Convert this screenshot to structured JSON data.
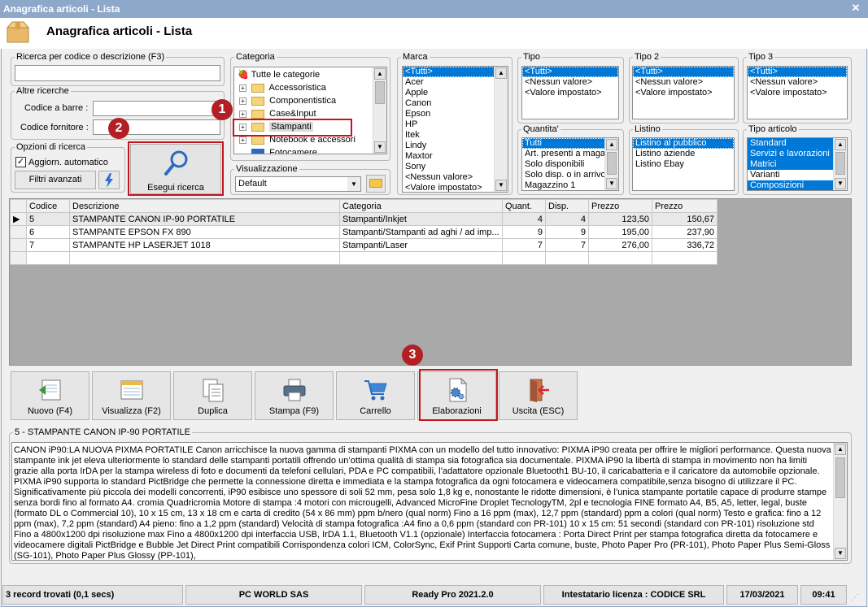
{
  "window": {
    "title": "Anagrafica articoli  - Lista"
  },
  "header": {
    "title": "Anagrafica articoli  - Lista"
  },
  "search": {
    "legend": "Ricerca per codice o descrizione (F3)",
    "value": "",
    "altre_legend": "Altre ricerche",
    "barcode_label": "Codice a barre :",
    "supplier_label": "Codice fornitore :",
    "options_legend": "Opzioni di ricerca",
    "auto_update_label": "Aggiorn. automatico",
    "advanced_filters": "Filtri avanzati",
    "execute_label": "Esegui ricerca"
  },
  "categoria": {
    "legend": "Categoria",
    "items": [
      "Tutte le categorie",
      "Accessoristica",
      "Componentistica",
      "Case&Input",
      "Stampanti",
      "Notebook e accessori",
      "Fotocamere"
    ]
  },
  "visualizzazione": {
    "legend": "Visualizzazione",
    "value": "Default"
  },
  "marca": {
    "legend": "Marca",
    "items": [
      "<Tutti>",
      "Acer",
      "Apple",
      "Canon",
      "Epson",
      "HP",
      "Itek",
      "Lindy",
      "Maxtor",
      "Sony",
      "<Nessun valore>",
      "<Valore impostato>"
    ]
  },
  "tipo": {
    "legend": "Tipo",
    "items": [
      "<Tutti>",
      "<Nessun valore>",
      "<Valore impostato>"
    ]
  },
  "tipo2": {
    "legend": "Tipo 2",
    "items": [
      "<Tutti>",
      "<Nessun valore>",
      "<Valore impostato>"
    ]
  },
  "tipo3": {
    "legend": "Tipo 3",
    "items": [
      "<Tutti>",
      "<Nessun valore>",
      "<Valore impostato>"
    ]
  },
  "quantita": {
    "legend": "Quantita'",
    "items": [
      "Tutti",
      "Art. presenti a magazzino",
      "Solo disponibili",
      "Solo disp. o in arrivo",
      "Magazzino 1"
    ]
  },
  "listino": {
    "legend": "Listino",
    "items": [
      "Listino al pubblico",
      "Listino aziende",
      "Listino Ebay"
    ]
  },
  "tipo_articolo": {
    "legend": "Tipo articolo",
    "items": [
      "Standard",
      "Servizi e lavorazioni",
      "Matrici",
      "Varianti",
      "Composizioni"
    ]
  },
  "grid": {
    "columns": [
      "Codice",
      "Descrizione",
      "Categoria",
      "Quant.",
      "Disp.",
      "Prezzo",
      "Prezzo"
    ],
    "rows": [
      [
        "5",
        "STAMPANTE CANON IP-90 PORTATILE",
        "Stampanti/Inkjet",
        "4",
        "4",
        "123,50",
        "150,67"
      ],
      [
        "6",
        "STAMPANTE EPSON FX 890",
        "Stampanti/Stampanti ad aghi / ad imp...",
        "9",
        "9",
        "195,00",
        "237,90"
      ],
      [
        "7",
        "STAMPANTE HP LASERJET 1018",
        "Stampanti/Laser",
        "7",
        "7",
        "276,00",
        "336,72"
      ]
    ]
  },
  "actions": [
    {
      "label": "Nuovo (F4)",
      "icon": "new-doc-icon"
    },
    {
      "label": "Visualizza (F2)",
      "icon": "view-list-icon"
    },
    {
      "label": "Duplica",
      "icon": "duplicate-icon"
    },
    {
      "label": "Stampa (F9)",
      "icon": "printer-icon"
    },
    {
      "label": "Carrello",
      "icon": "cart-icon"
    },
    {
      "label": "Elaborazioni",
      "icon": "gear-doc-icon"
    },
    {
      "label": "Uscita (ESC)",
      "icon": "exit-icon"
    }
  ],
  "detail": {
    "legend": "5 - STAMPANTE CANON IP-90 PORTATILE",
    "text": "CANON iP90:LA NUOVA PIXMA PORTATILE Canon arricchisce la nuova gamma di stampanti PIXMA con un modello del tutto innovativo: PIXMA iP90 creata per offrire le migliori performance. Questa nuova stampante ink jet eleva ulteriormente lo standard delle stampanti portatili offrendo un’ottima qualità di stampa sia fotografica sia documentale. PIXMA iP90 la libertà di stampa in movimento non ha limiti grazie alla porta IrDA per la stampa wireless di foto e documenti da telefoni cellulari, PDA e PC compatibili, l’adattatore opzionale Bluetooth1 BU-10, il caricabatteria e il caricatore da automobile opzionale. PIXMA iP90 supporta lo standard PictBridge che permette la connessione diretta e immediata e la stampa fotografica da ogni fotocamera e videocamera compatibile,senza bisogno di utilizzare il PC. Significativamente più piccola dei modelli concorrenti, iP90 esibisce uno spessore di soli 52 mm, pesa solo 1,8 kg e, nonostante le ridotte dimensioni, è l’unica stampante portatile capace di produrre stampe senza bordi fino al formato A4. cromia Quadricromia Motore di stampa :4 motori con microugelli, Advanced MicroFine Droplet TecnologyTM, 2pl e tecnologia FINE formato A4, B5, A5, letter, legal, buste (formato DL o Commercial 10), 10 x 15 cm, 13 x 18 cm e carta di credito (54 x 86 mm) ppm b/nero (qual norm) Fino a 16 ppm (max), 12,7 ppm (standard) ppm a colori (qual norm) Testo e grafica: fino a 12 ppm (max), 7,2 ppm (standard) A4 pieno: fino a 1,2 ppm (standard) Velocità di stampa fotografica :A4 fino a 0,6 ppm (standard con PR-101) 10 x 15 cm: 51 secondi (standard con PR-101) risoluzione std Fino a 4800x1200 dpi risoluzione max Fino a 4800x1200 dpi interfaccia USB, IrDA 1.1, Bluetooth V1.1 (opzionale) Interfaccia fotocamera : Porta Direct Print per stampa fotografica diretta da fotocamere e videocamere digitali PictBridge e Bubble Jet Direct Print compatibili Corrispondenza colori ICM, ColorSync, Exif Print Supporti Carta comune, buste, Photo Paper Pro (PR-101), Photo Paper Plus Semi-Gloss (SG-101), Photo Paper Plus Glossy (PP-101),"
  },
  "badges": [
    "1",
    "2",
    "3"
  ],
  "status": {
    "records": "3 record trovati (0,1 secs)",
    "company": "PC WORLD SAS",
    "version": "Ready Pro 2021.2.0",
    "license": "Intestatario licenza : CODICE SRL",
    "date": "17/03/2021",
    "time": "09:41"
  },
  "colors": {
    "selection": "#0078d7",
    "highlight": "#c4161c",
    "titlebar": "#8ea8c9"
  }
}
